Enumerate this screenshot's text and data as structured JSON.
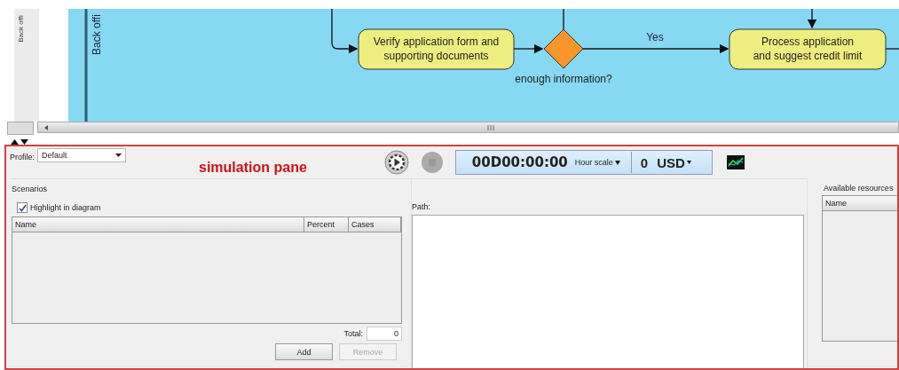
{
  "side_panel": {
    "label": "Back offi"
  },
  "diagram": {
    "lane": {
      "label": "Back offi"
    },
    "nodes": [
      {
        "kind": "task",
        "lines": [
          "Verify application form and",
          "supporting documents"
        ]
      },
      {
        "kind": "gateway",
        "lines": [
          "enough information?"
        ]
      },
      {
        "kind": "task",
        "lines": [
          "Process application",
          "and suggest credit limit"
        ]
      }
    ],
    "flows": [
      {
        "label": "Yes"
      }
    ]
  },
  "simulation": {
    "profile": {
      "label": "Profile:",
      "value": "Default"
    },
    "title": "simulation pane",
    "timer": {
      "time": "00D00:00:00",
      "scale": "Hour scale",
      "cost": "0",
      "currency": "USD"
    },
    "scenarios": {
      "title": "Scenarios",
      "highlight": {
        "label": "Highlight in diagram",
        "checked": true
      },
      "columns": [
        "Name",
        "Percent",
        "Cases"
      ],
      "total_label": "Total:",
      "total": "0",
      "buttons": [
        {
          "label": "Add",
          "disabled": false
        },
        {
          "label": "Remove",
          "disabled": true
        }
      ]
    },
    "path": {
      "label": "Path:"
    },
    "resources": {
      "title": "Available resources",
      "columns": [
        "Name"
      ]
    }
  }
}
